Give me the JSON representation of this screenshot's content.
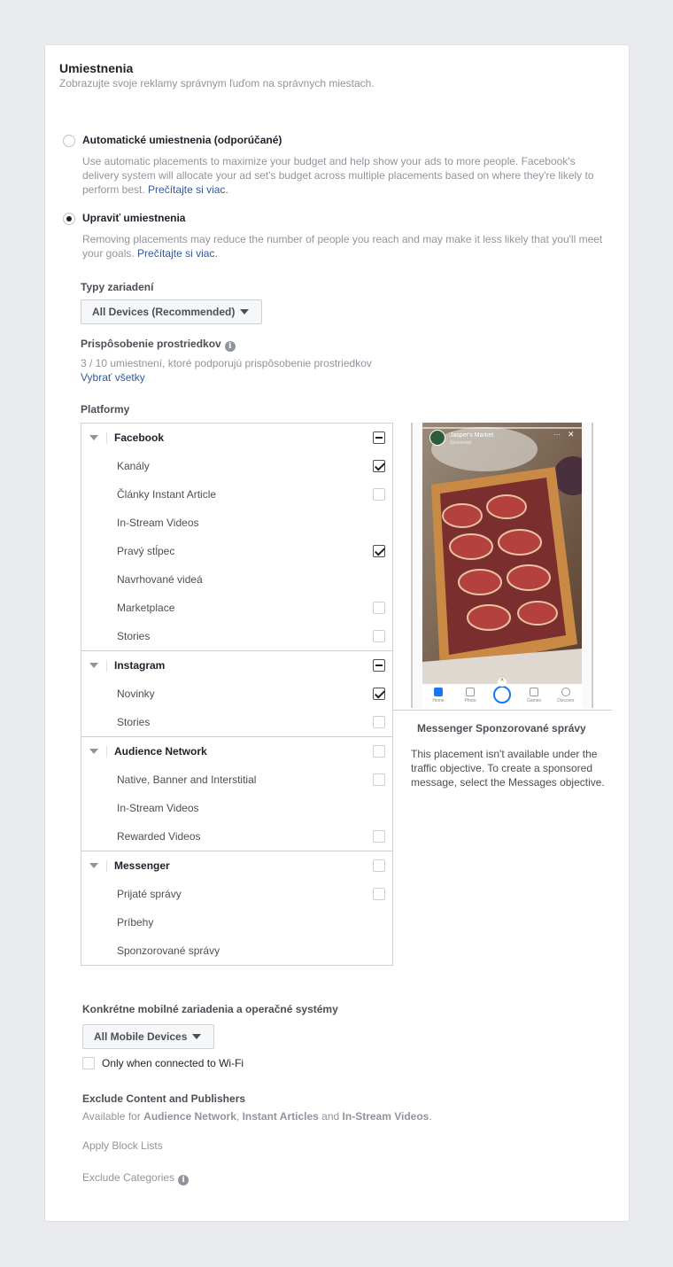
{
  "header": {
    "title": "Umiestnenia",
    "subtitle": "Zobrazujte svoje reklamy správnym ľuďom na správnych miestach."
  },
  "automatic": {
    "label": "Automatické umiestnenia (odporúčané)",
    "description": "Use automatic placements to maximize your budget and help show your ads to more people. Facebook's delivery system will allocate your ad set's budget across multiple placements based on where they're likely to perform best.",
    "link": "Prečítajte si viac."
  },
  "edit": {
    "label": "Upraviť umiestnenia",
    "description": "Removing placements may reduce the number of people you reach and may make it less likely that you'll meet your goals.",
    "link": "Prečítajte si viac."
  },
  "devices": {
    "label": "Typy zariadení",
    "value": "All Devices (Recommended)"
  },
  "customization": {
    "label": "Prispôsobenie prostriedkov",
    "info": "3 / 10 umiestnení, ktoré podporujú prispôsobenie prostriedkov",
    "select_all": "Vybrať všetky"
  },
  "platforms": {
    "label": "Platformy",
    "groups": [
      {
        "name": "Facebook",
        "items": [
          {
            "label": "Kanály"
          },
          {
            "label": "Články Instant Article"
          },
          {
            "label": "In-Stream Videos"
          },
          {
            "label": "Pravý stĺpec"
          },
          {
            "label": "Navrhované videá"
          },
          {
            "label": "Marketplace"
          },
          {
            "label": "Stories"
          }
        ]
      },
      {
        "name": "Instagram",
        "items": [
          {
            "label": "Novinky"
          },
          {
            "label": "Stories"
          }
        ]
      },
      {
        "name": "Audience Network",
        "items": [
          {
            "label": "Native, Banner and Interstitial"
          },
          {
            "label": "In-Stream Videos"
          },
          {
            "label": "Rewarded Videos"
          }
        ]
      },
      {
        "name": "Messenger",
        "items": [
          {
            "label": "Prijaté správy"
          },
          {
            "label": "Príbehy"
          },
          {
            "label": "Sponzorované správy"
          }
        ]
      }
    ]
  },
  "preview": {
    "brand": "Jasper's Market",
    "sponsored": "Sponsored",
    "tabs": [
      "Home",
      "Photo",
      "",
      "Games",
      "Discover"
    ],
    "title": "Messenger Sponzorované správy",
    "description": "This placement isn't available under the traffic objective. To create a sponsored message, select the Messages objective."
  },
  "mobile": {
    "label": "Konkrétne mobilné zariadenia a operačné systémy",
    "value": "All Mobile Devices",
    "wifi_label": "Only when connected to Wi-Fi"
  },
  "exclude": {
    "label": "Exclude Content and Publishers",
    "available_prefix": "Available for",
    "an": "Audience Network",
    "sep1": ",",
    "ia": "Instant Articles",
    "and": "and",
    "isv": "In-Stream Videos",
    "period": ".",
    "block_lists": "Apply Block Lists",
    "categories": "Exclude Categories"
  },
  "colors": {
    "link": "#365899",
    "muted": "#90949c",
    "border": "#ced0d4",
    "background": "#e9ebee"
  }
}
